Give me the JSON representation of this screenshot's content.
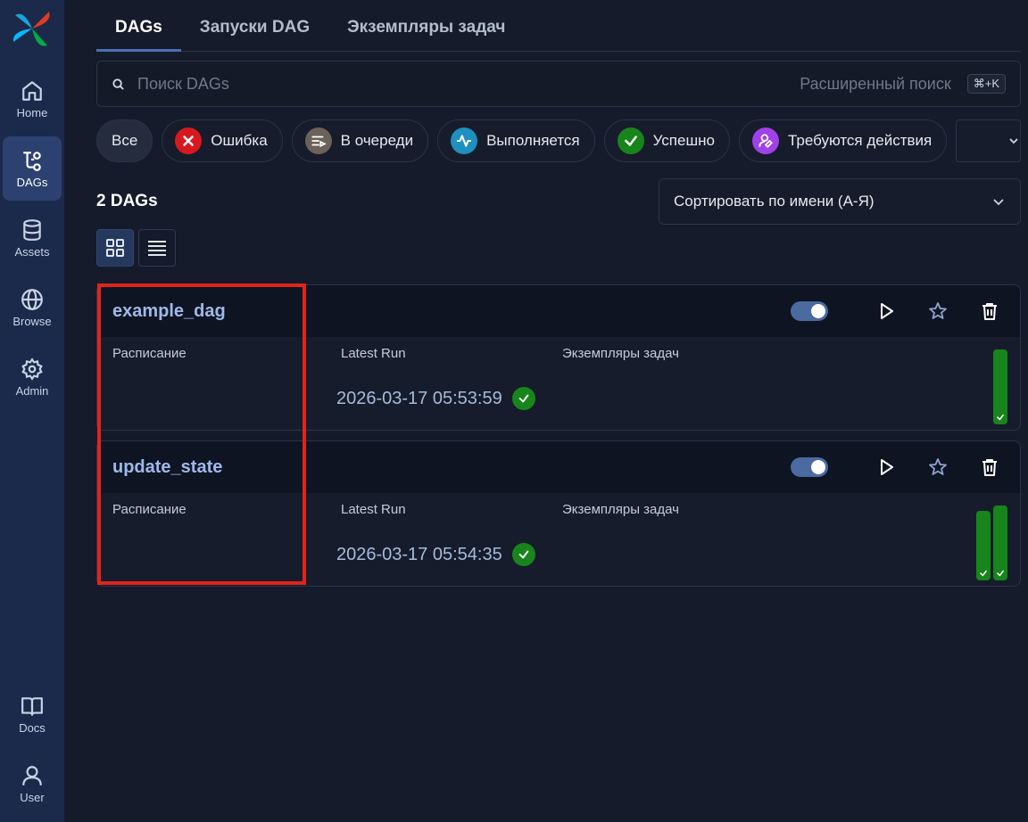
{
  "sidebar": {
    "items": [
      {
        "label": "Home",
        "icon": "home-icon"
      },
      {
        "label": "DAGs",
        "icon": "dags-icon",
        "active": true
      },
      {
        "label": "Assets",
        "icon": "database-icon"
      },
      {
        "label": "Browse",
        "icon": "globe-icon"
      },
      {
        "label": "Admin",
        "icon": "gear-icon"
      }
    ],
    "bottom_items": [
      {
        "label": "Docs",
        "icon": "book-icon"
      },
      {
        "label": "User",
        "icon": "user-icon"
      }
    ]
  },
  "tabs": [
    "DAGs",
    "Запуски DAG",
    "Экземпляры задач"
  ],
  "search": {
    "placeholder": "Поиск DAGs",
    "advanced_label": "Расширенный поиск",
    "shortcut": "⌘+K"
  },
  "filters": [
    {
      "label": "Все"
    },
    {
      "label": "Ошибка",
      "color": "#d7191f"
    },
    {
      "label": "В очереди",
      "color": "#6b625a"
    },
    {
      "label": "Выполняется",
      "color": "#1e8fbf"
    },
    {
      "label": "Успешно",
      "color": "#17851c"
    },
    {
      "label": "Требуются действия",
      "color": "#a040e8"
    }
  ],
  "count_label": "2 DAGs",
  "sort": {
    "label": "Сортировать по имени (А-Я)"
  },
  "dags": [
    {
      "name": "example_dag",
      "schedule_label": "Расписание",
      "latest_run_label": "Latest Run",
      "task_instances_label": "Экземпляры задач",
      "latest_run": "2026-03-17 05:53:59",
      "enabled": true,
      "run_bars": [
        1.0
      ]
    },
    {
      "name": "update_state",
      "schedule_label": "Расписание",
      "latest_run_label": "Latest Run",
      "task_instances_label": "Экземпляры задач",
      "latest_run": "2026-03-17 05:54:35",
      "enabled": true,
      "run_bars": [
        0.93,
        1.0
      ]
    }
  ],
  "colors": {
    "success": "#17851c",
    "accent": "#4a6fb3",
    "highlight": "#e0241b"
  }
}
